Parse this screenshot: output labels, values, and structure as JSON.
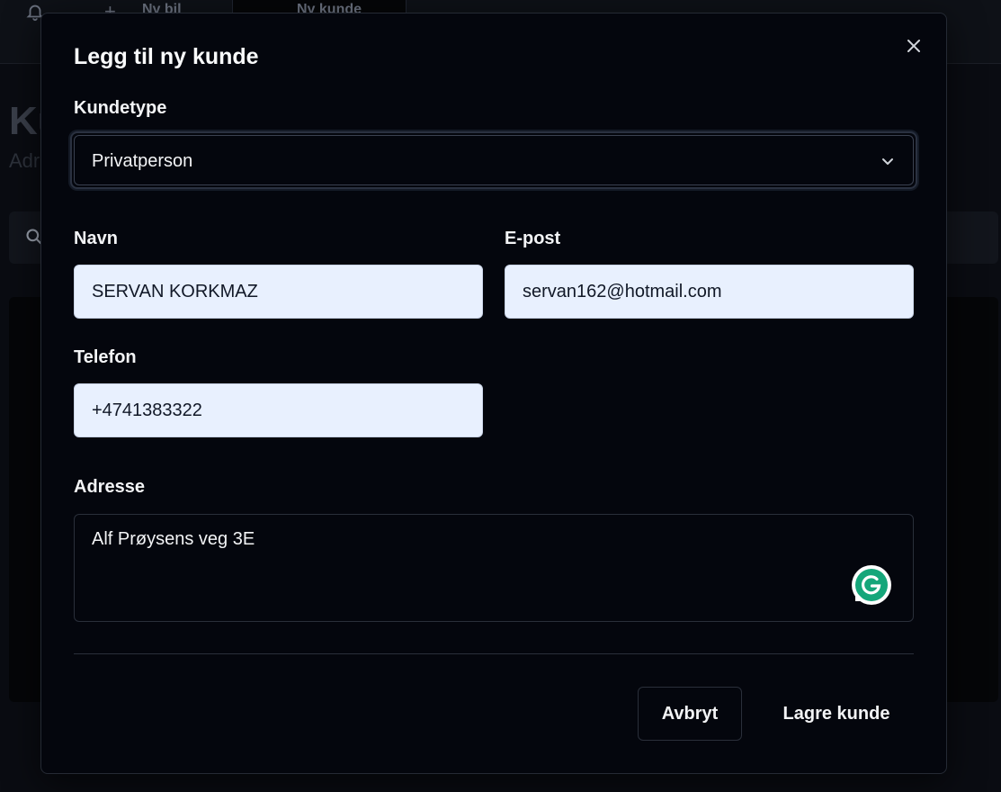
{
  "background": {
    "nav": {
      "new_car_label": "Ny bil",
      "new_customer_label": "Ny kunde"
    },
    "page_title": "Ku",
    "page_subtitle": "Adr"
  },
  "modal": {
    "title": "Legg til ny kunde",
    "customer_type": {
      "label": "Kundetype",
      "value": "Privatperson"
    },
    "name": {
      "label": "Navn",
      "value": "SERVAN KORKMAZ"
    },
    "email": {
      "label": "E-post",
      "value": "servan162@hotmail.com"
    },
    "phone": {
      "label": "Telefon",
      "value": "+4741383322"
    },
    "address": {
      "label": "Adresse",
      "value": "Alf Prøysens veg 3E"
    },
    "buttons": {
      "cancel": "Avbryt",
      "save": "Lagre kunde"
    }
  },
  "icons": {
    "close": "close-icon",
    "chevron": "chevron-down-icon",
    "grammarly": "grammarly-icon",
    "bell": "bell-icon",
    "search": "search-icon"
  },
  "colors": {
    "modal_bg": "#04060d",
    "input_autofill_bg": "#e8f0fe",
    "grammarly_green": "#15a67a"
  }
}
